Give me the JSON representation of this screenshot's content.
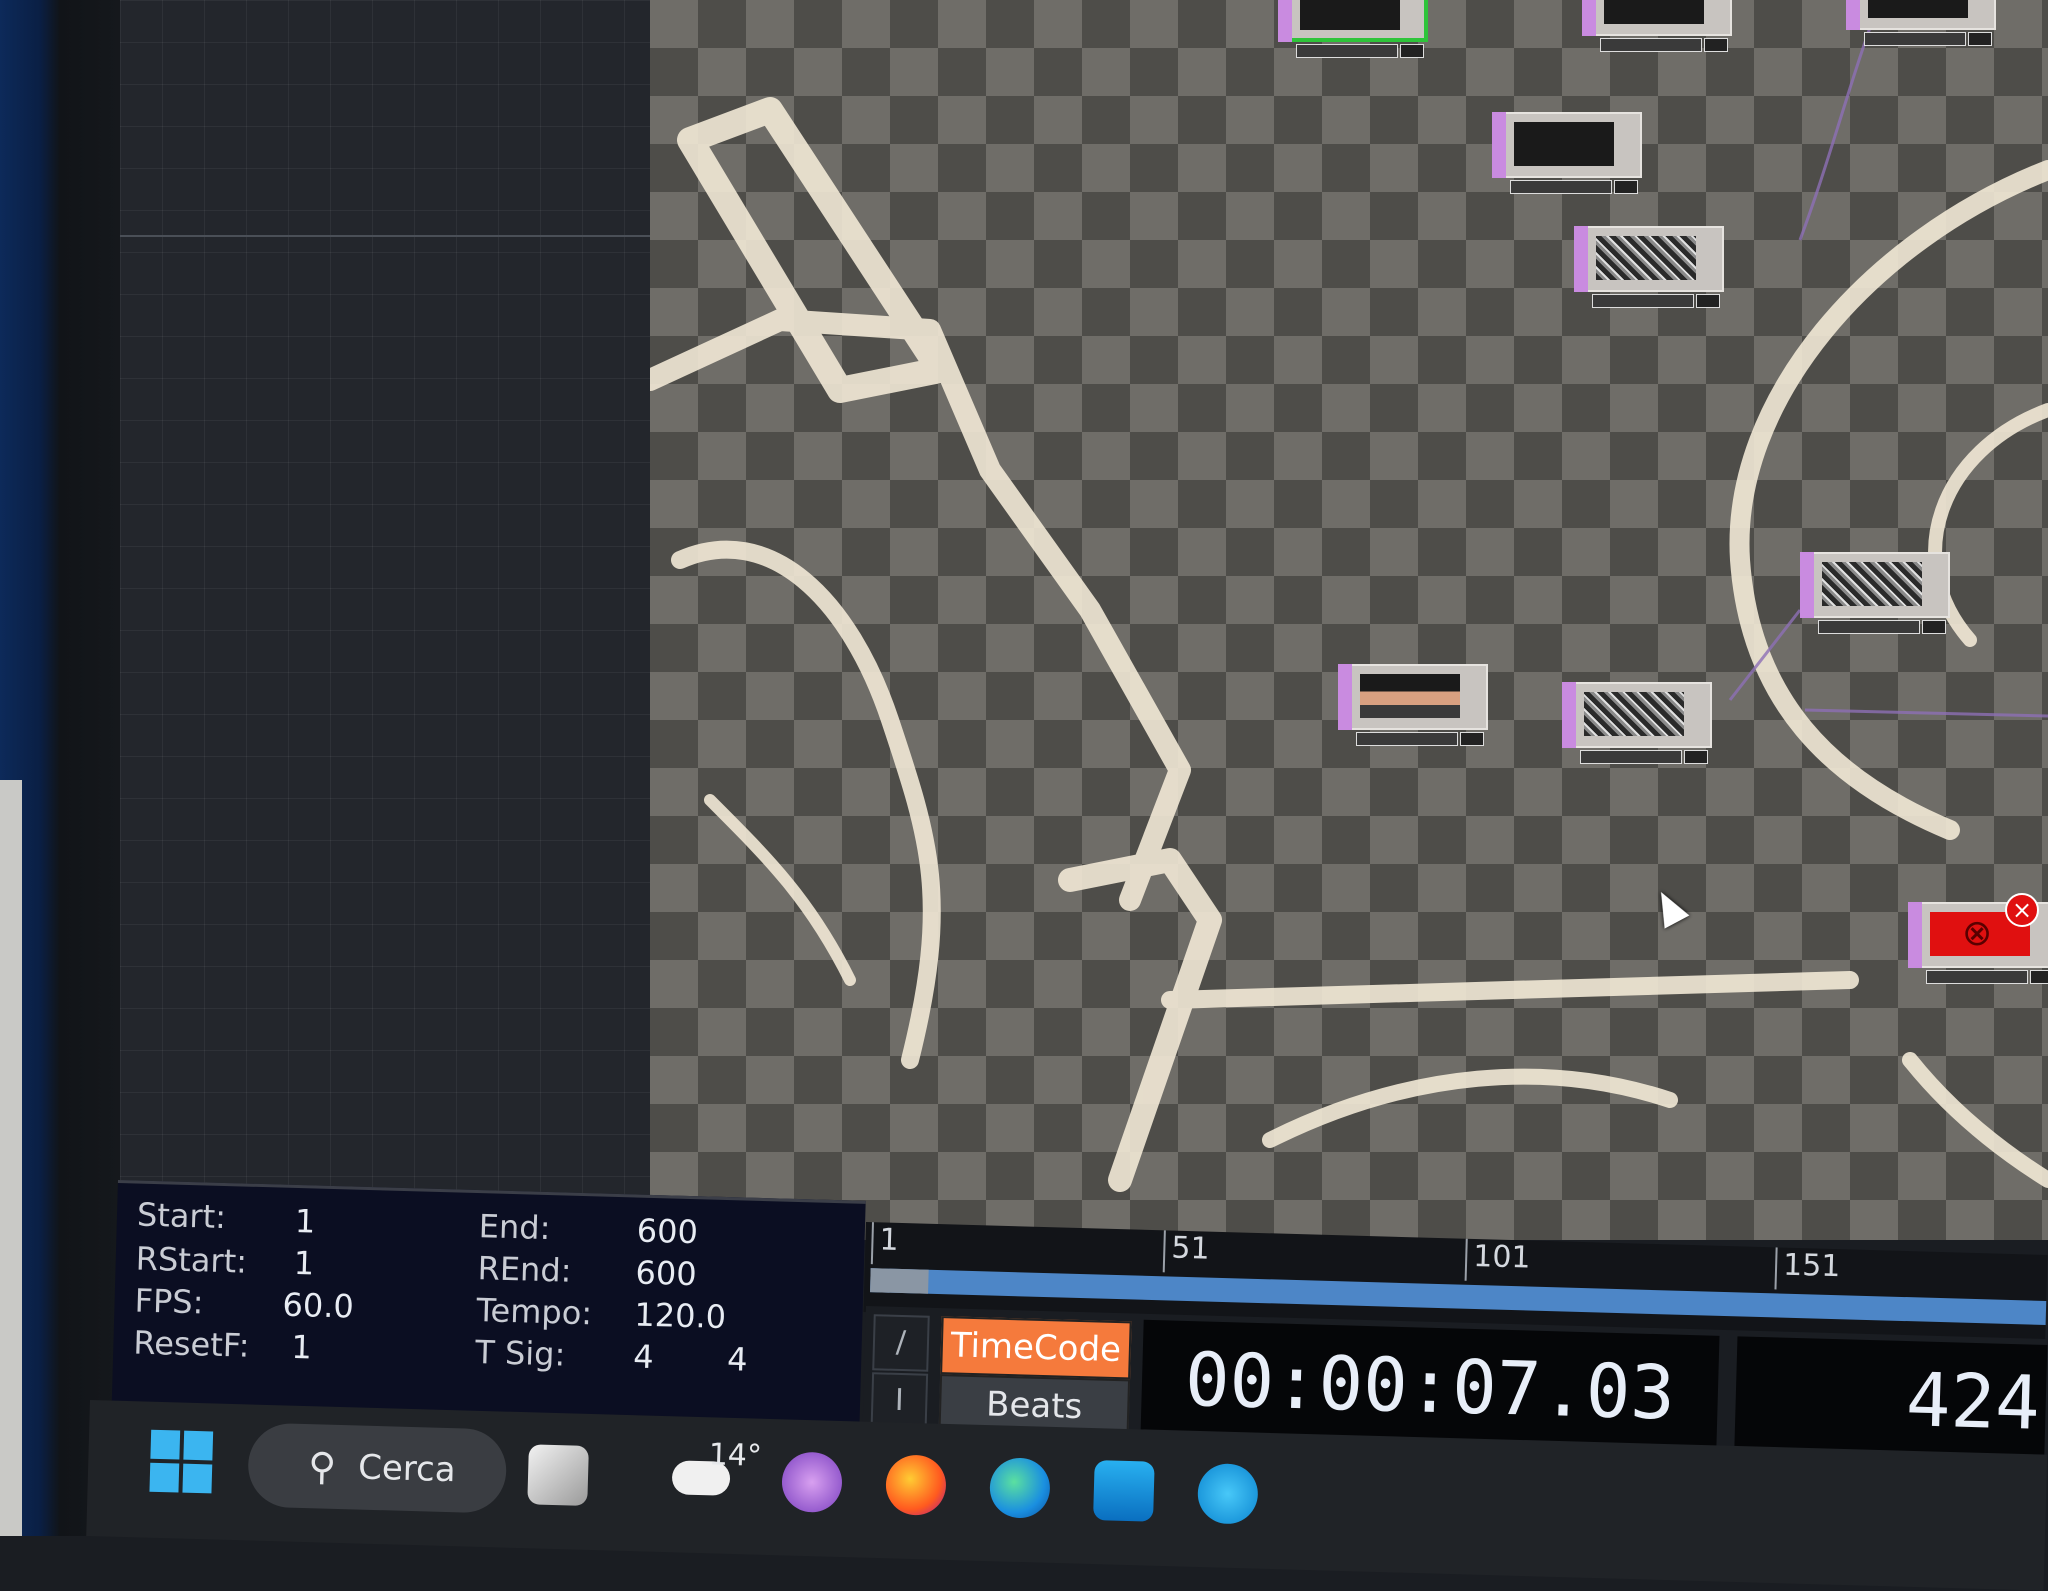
{
  "timeline": {
    "start_label": "Start:",
    "start_value": "1",
    "rstart_label": "RStart:",
    "rstart_value": "1",
    "fps_label": "FPS:",
    "fps_value": "60.0",
    "resetf_label": "ResetF:",
    "resetf_value": "1",
    "end_label": "End:",
    "end_value": "600",
    "rend_label": "REnd:",
    "rend_value": "600",
    "tempo_label": "Tempo:",
    "tempo_value": "120.0",
    "tsig_label": "T Sig:",
    "tsig_num": "4",
    "tsig_den": "4"
  },
  "ruler": {
    "ticks": [
      "1",
      "51",
      "101",
      "151"
    ]
  },
  "controls": {
    "slash_glyph": "/",
    "bar_glyph": "I",
    "timecode_label": "TimeCode",
    "beats_label": "Beats",
    "timecode_value": "00:00:07.03",
    "frame_value": "424"
  },
  "taskbar": {
    "search_label": "Cerca",
    "weather_temp": "14°"
  },
  "colors": {
    "timecode_active": "#f57a3c",
    "node_flag": "#c98be0",
    "selected_node": "#2ec43a",
    "error": "#e01010",
    "timeline_bar": "#4d86c7"
  },
  "icons": [
    "windows-start-icon",
    "search-icon",
    "task-view-icon",
    "weather-cloud-icon",
    "video-call-icon",
    "firefox-icon",
    "edge-icon",
    "store-icon"
  ]
}
